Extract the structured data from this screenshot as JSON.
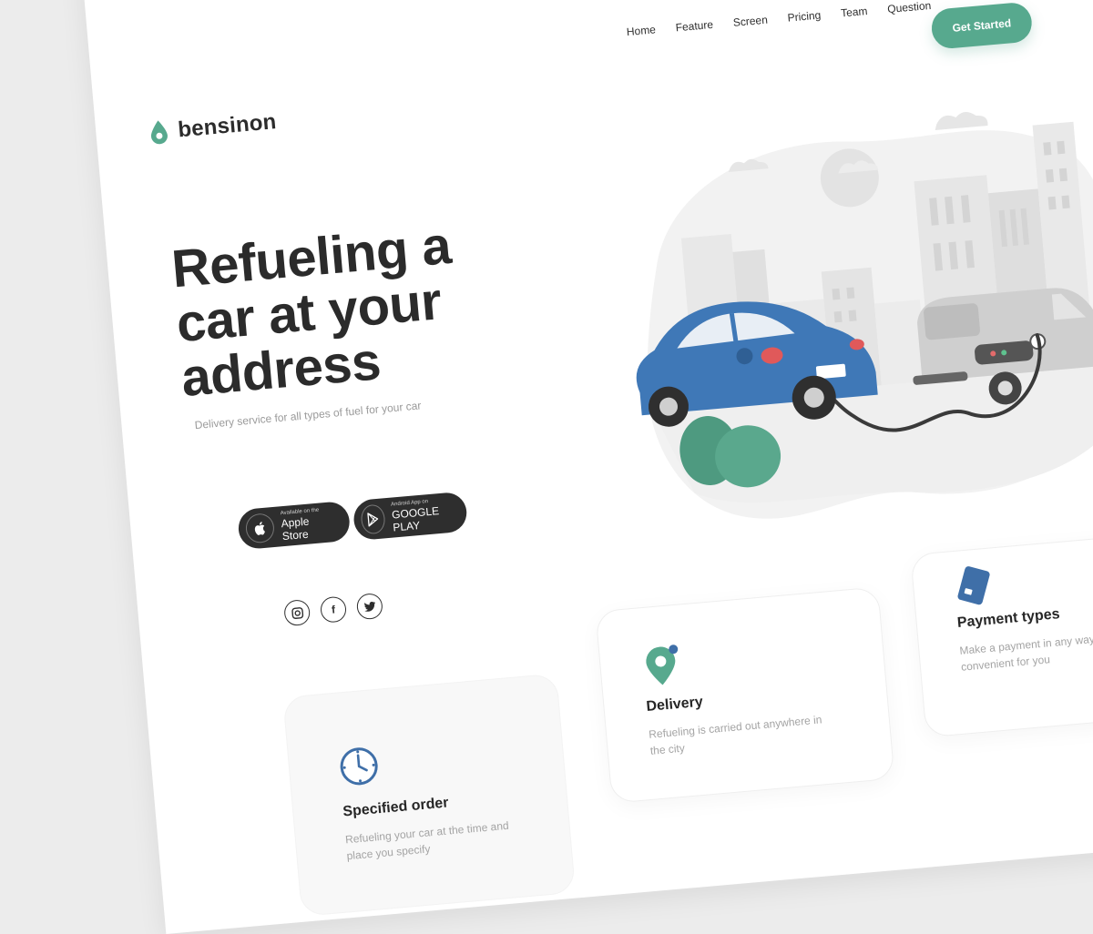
{
  "brand": {
    "name": "bensinon",
    "accent": "#57a98e",
    "dark": "#2e2e2e"
  },
  "nav": {
    "items": [
      {
        "label": "Home"
      },
      {
        "label": "Feature"
      },
      {
        "label": "Screen"
      },
      {
        "label": "Pricing"
      },
      {
        "label": "Team"
      },
      {
        "label": "Question"
      }
    ],
    "cta": "Get Started"
  },
  "hero": {
    "title": "Refueling a car at your address",
    "subtitle": "Delivery service for all types of fuel for your car"
  },
  "stores": {
    "apple": {
      "small": "Available on the",
      "big": "Apple Store",
      "icon": "apple-icon"
    },
    "google": {
      "small": "Android App on",
      "big": "GOOGLE PLAY",
      "icon": "play-icon"
    }
  },
  "social": [
    {
      "icon": "instagram-icon"
    },
    {
      "icon": "facebook-icon",
      "glyph": "f"
    },
    {
      "icon": "twitter-icon"
    }
  ],
  "features": [
    {
      "title": "Specified order",
      "desc": "Refueling your car at the time and place you specify",
      "icon": "clock-icon"
    },
    {
      "title": "Delivery",
      "desc": "Refueling is carried out anywhere in the city",
      "icon": "location-pin-icon"
    },
    {
      "title": "Payment types",
      "desc": "Make a payment in any way convenient for you",
      "icon": "credit-card-icon"
    }
  ]
}
